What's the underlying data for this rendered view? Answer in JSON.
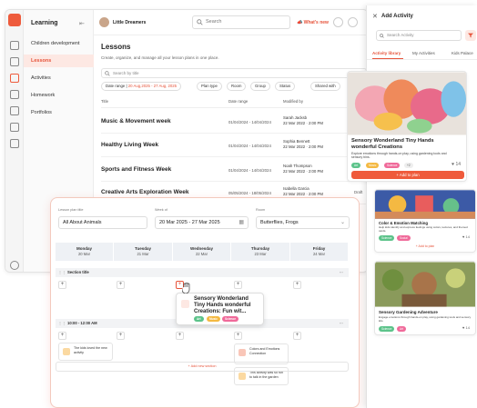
{
  "app": {
    "sidebar_title": "Learning",
    "nav": [
      "Children development",
      "Lessons",
      "Activities",
      "Homework",
      "Portfolios"
    ],
    "center_name": "Little Dreamers",
    "search_placeholder": "Search",
    "whats_new": "What's new"
  },
  "lessons": {
    "title": "Lessons",
    "subtitle": "Create, organize, and manage all your lesson plans in one place.",
    "search_placeholder": "Search by title",
    "filters": {
      "date_range_label": "Date range",
      "date_range_value": "20 Aug,2025 - 27 Aug, 2025",
      "plan_type": "Plan type",
      "room": "Room",
      "group": "Group",
      "status": "Status",
      "shared": "Shared with"
    },
    "columns": [
      "Title",
      "Date range",
      "Modified by"
    ],
    "rows": [
      {
        "title": "Music & Movement week",
        "date": "01/04/2024 - 14/04/2024",
        "name": "Sarah Jacksb",
        "mod": "22 Mar 2022 · 2:00 PM"
      },
      {
        "title": "Healthy Living Week",
        "date": "01/04/2024 - 14/04/2024",
        "name": "Sophia Bennett",
        "mod": "22 Mar 2022 · 2:00 PM"
      },
      {
        "title": "Sports and Fitness Week",
        "date": "01/04/2024 - 14/04/2024",
        "name": "Noah Thompson",
        "mod": "22 Mar 2022 · 2:00 PM"
      },
      {
        "title": "Creative Arts Exploration Week",
        "date": "05/05/2024 - 18/05/2024",
        "name": "Isabella Garcia",
        "mod": "22 Mar 2022 · 2:00 PM"
      }
    ],
    "draft_badge": "Draft"
  },
  "panel": {
    "title": "Add Activity",
    "search_placeholder": "Search Activity",
    "tabs": [
      "Activity library",
      "My Activities",
      "Kids Palace"
    ],
    "cards": [
      {
        "title": "Sensory Wonderland Tiny Hands wonderful Creations",
        "desc": "Explore emotions through hands-on play, using gardening tools and sensory bins.",
        "tags": [
          "Art",
          "Music",
          "Science"
        ],
        "more": "+2",
        "likes": "14",
        "button": "Add to plan"
      },
      {
        "title": "Color & Emotion Matching",
        "desc": "Help kids identify and express feelings using colors, textures, and themed cards.",
        "tags": [
          "Science",
          "Social"
        ],
        "likes": "14",
        "button": "Add to plan"
      },
      {
        "title": "Sensory Gardening Adventure",
        "desc": "Engage emotions through hands-on play, using gardening tools and sensory kits.",
        "tags": [
          "Science",
          "Art"
        ],
        "likes": "14"
      }
    ]
  },
  "planner": {
    "plan_title_label": "Lesson plan title",
    "plan_title": "All About Animals",
    "week_label": "Week of",
    "week_value": "20 Mar 2025 - 27 Mar 2025",
    "room_label": "Room",
    "room_value": "Butterflies, Frogs",
    "days": [
      {
        "name": "Monday",
        "date": "20 Mar"
      },
      {
        "name": "Tuesday",
        "date": "21 Mar"
      },
      {
        "name": "Wednesday",
        "date": "22 Mar"
      },
      {
        "name": "Thursday",
        "date": "23 Mar"
      },
      {
        "name": "Friday",
        "date": "24 Mar"
      }
    ],
    "section1": "Section title",
    "section2": "10:00 - 12:00 AM",
    "dragged_card": "Sensory Wonderland Tiny Hands wonderful Creations: Fun wit...",
    "mon_activity": "The kids loved the new activity",
    "thu_activity1": "Colors and Emotions Connection",
    "thu_activity2": "This activity was so fun to talk in the garden",
    "add_section": "Add new section"
  },
  "colors": {
    "accent": "#ee5b3c",
    "accent_light": "#fde8e3",
    "tag_green": "#5cc38a",
    "tag_yellow": "#f4b942",
    "tag_pink": "#f06a9a"
  }
}
